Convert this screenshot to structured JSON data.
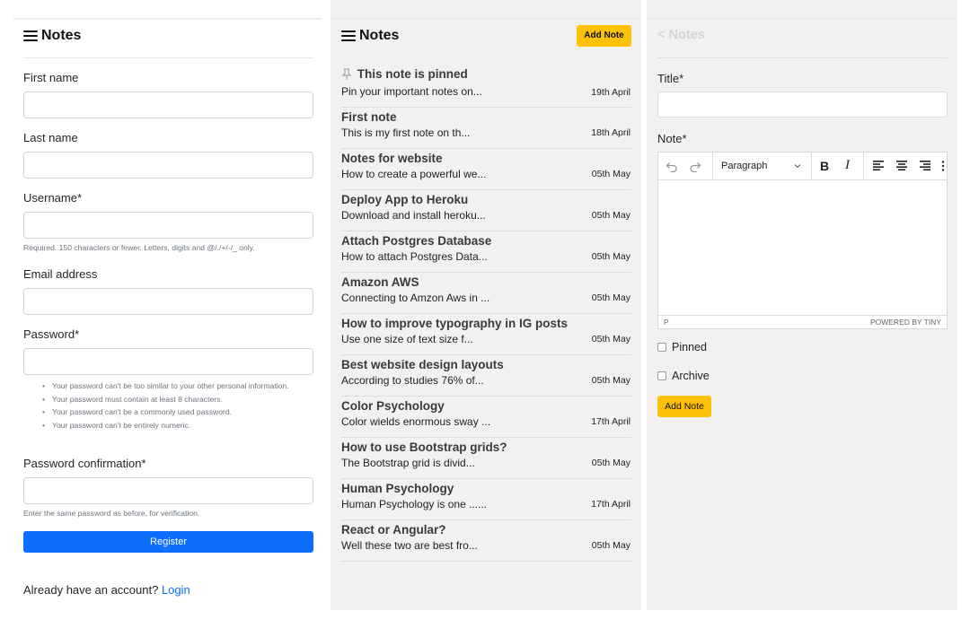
{
  "app": {
    "title": "Notes"
  },
  "register": {
    "fields": {
      "first_name": {
        "label": "First name",
        "value": ""
      },
      "last_name": {
        "label": "Last name",
        "value": ""
      },
      "username": {
        "label": "Username*",
        "value": "",
        "help": "Required. 150 characters or fewer. Letters, digits and @/./+/-/_ only."
      },
      "email": {
        "label": "Email address",
        "value": ""
      },
      "password": {
        "label": "Password*",
        "value": ""
      },
      "password_confirm": {
        "label": "Password confirmation*",
        "value": "",
        "help": "Enter the same password as before, for verification."
      }
    },
    "password_rules": [
      "Your password can't be too similar to your other personal information.",
      "Your password must contain at least 8 characters.",
      "Your password can't be a commonly used password.",
      "Your password can't be entirely numeric."
    ],
    "submit_label": "Register",
    "login_prompt": "Already have an account?",
    "login_link": "Login"
  },
  "notes_list": {
    "add_button": "Add Note",
    "pinned": {
      "title": "This note is pinned",
      "preview": "Pin your important notes on...",
      "date": "19th April"
    },
    "items": [
      {
        "title": "First note",
        "preview": "This is my first note on th...",
        "date": "18th April"
      },
      {
        "title": "Notes for website",
        "preview": "How to create a powerful we...",
        "date": "05th May"
      },
      {
        "title": "Deploy App to Heroku",
        "preview": "Download and install heroku...",
        "date": "05th May"
      },
      {
        "title": "Attach Postgres Database",
        "preview": "How to attach Postgres Data...",
        "date": "05th May"
      },
      {
        "title": "Amazon AWS",
        "preview": "Connecting to Amzon Aws in ...",
        "date": "05th May"
      },
      {
        "title": "How to improve typography in IG posts",
        "preview": "Use one size of text size f...",
        "date": "05th May"
      },
      {
        "title": "Best website design layouts",
        "preview": "According to studies 76% of...",
        "date": "05th May"
      },
      {
        "title": "Color Psychology",
        "preview": "Color wields enormous sway ...",
        "date": "17th April"
      },
      {
        "title": "How to use Bootstrap grids?",
        "preview": "The Bootstrap grid is divid...",
        "date": "05th May"
      },
      {
        "title": "Human Psychology",
        "preview": "Human Psychology is one ......",
        "date": "17th April"
      },
      {
        "title": "React or Angular?",
        "preview": "Well these two are best fro...",
        "date": "05th May"
      }
    ]
  },
  "add_note": {
    "back_label": "< Notes",
    "title_label": "Title*",
    "note_label": "Note*",
    "editor": {
      "block_format": "Paragraph",
      "status_path": "P",
      "powered_by": "POWERED BY TINY",
      "icons": [
        "undo-icon",
        "redo-icon",
        "bold-icon",
        "italic-icon",
        "align-left-icon",
        "align-center-icon",
        "align-right-icon",
        "more-icon"
      ]
    },
    "pinned_label": "Pinned",
    "archive_label": "Archive",
    "submit_label": "Add Note"
  },
  "colors": {
    "primary": "#0d6efd",
    "accent": "#ffc107",
    "panel_bg": "#f2f1ef"
  }
}
